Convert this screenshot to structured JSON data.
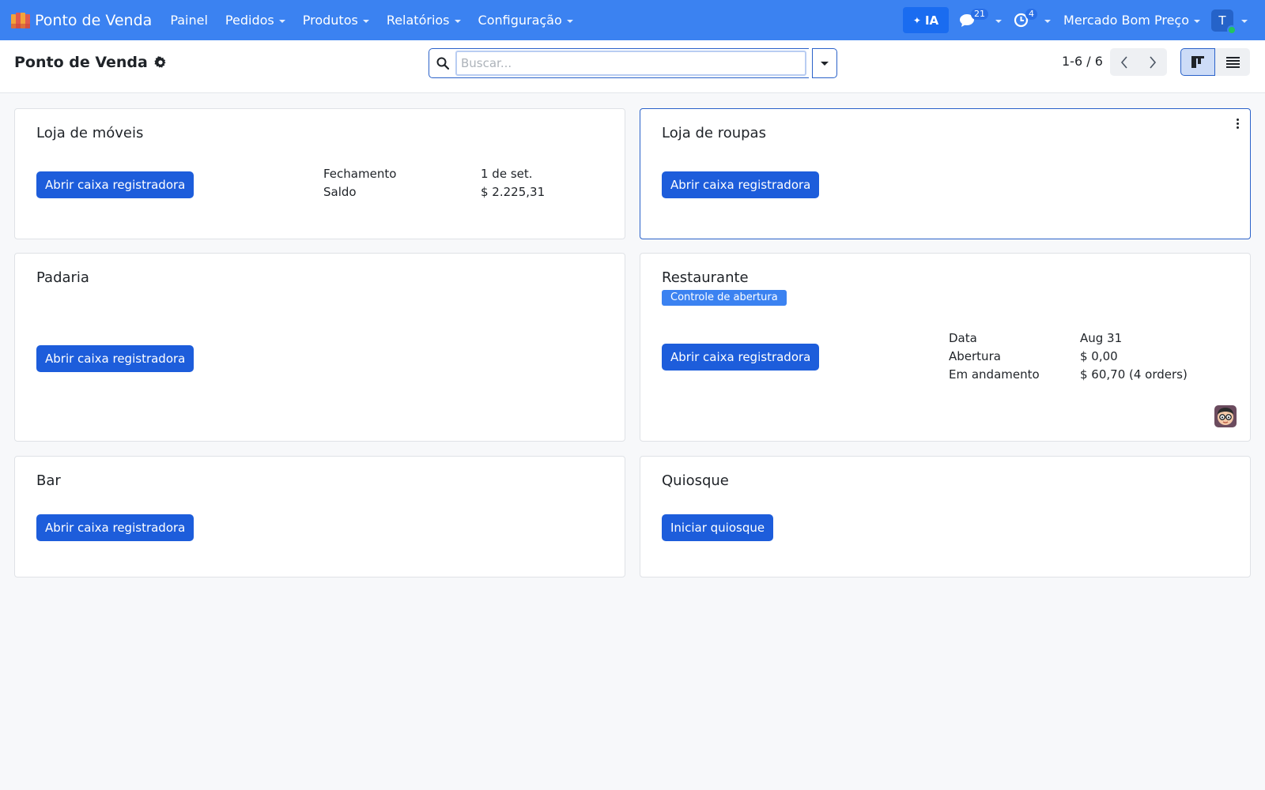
{
  "navbar": {
    "app_name": "Ponto de Venda",
    "menu": [
      {
        "label": "Painel",
        "has_caret": false
      },
      {
        "label": "Pedidos",
        "has_caret": true
      },
      {
        "label": "Produtos",
        "has_caret": true
      },
      {
        "label": "Relatórios",
        "has_caret": true
      },
      {
        "label": "Configuração",
        "has_caret": true
      }
    ],
    "ai_label": "IA",
    "messages_count": "21",
    "activities_count": "4",
    "company": "Mercado Bom Preço",
    "user_initial": "T"
  },
  "control_panel": {
    "title": "Ponto de Venda",
    "search_placeholder": "Buscar...",
    "pager": "1-6 / 6"
  },
  "cards": [
    {
      "title": "Loja de móveis",
      "button": "Abrir caixa registradora",
      "info": [
        {
          "label": "Fechamento",
          "value": "1 de set."
        },
        {
          "label": "Saldo",
          "value": "$ 2.225,31"
        }
      ]
    },
    {
      "title": "Loja de roupas",
      "button": "Abrir caixa registradora"
    },
    {
      "title": "Padaria",
      "button": "Abrir caixa registradora"
    },
    {
      "title": "Restaurante",
      "tag": "Controle de abertura",
      "button": "Abrir caixa registradora",
      "info": [
        {
          "label": "Data",
          "value": "Aug 31"
        },
        {
          "label": "Abertura",
          "value": "$ 0,00"
        },
        {
          "label": "Em andamento",
          "value": "$ 60,70 (4 orders)"
        }
      ]
    },
    {
      "title": "Bar",
      "button": "Abrir caixa registradora"
    },
    {
      "title": "Quiosque",
      "button": "Iniciar quiosque"
    }
  ],
  "colors": {
    "navbar": "#3b82f1",
    "primary_button": "#1d5ddb",
    "tag": "#3b82f1",
    "status_online": "#22c55e"
  }
}
